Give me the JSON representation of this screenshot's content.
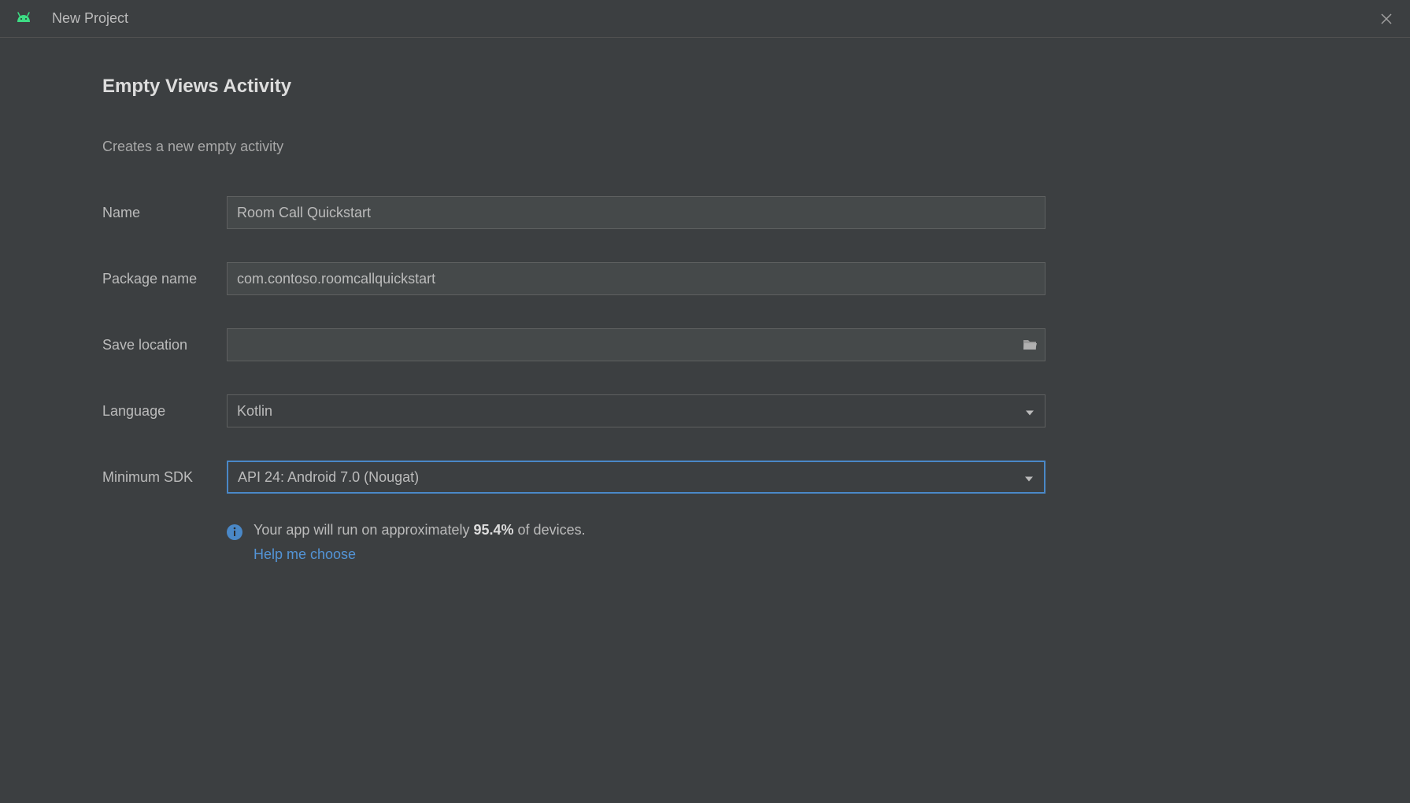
{
  "titlebar": {
    "title": "New Project"
  },
  "page": {
    "heading": "Empty Views Activity",
    "description": "Creates a new empty activity"
  },
  "form": {
    "name": {
      "label": "Name",
      "value": "Room Call Quickstart"
    },
    "package_name": {
      "label": "Package name",
      "value": "com.contoso.roomcallquickstart"
    },
    "save_location": {
      "label": "Save location",
      "value": ""
    },
    "language": {
      "label": "Language",
      "value": "Kotlin"
    },
    "minimum_sdk": {
      "label": "Minimum SDK",
      "value": "API 24: Android 7.0 (Nougat)"
    }
  },
  "info": {
    "text_prefix": "Your app will run on approximately ",
    "percentage": "95.4%",
    "text_suffix": " of devices.",
    "help_link": "Help me choose"
  }
}
